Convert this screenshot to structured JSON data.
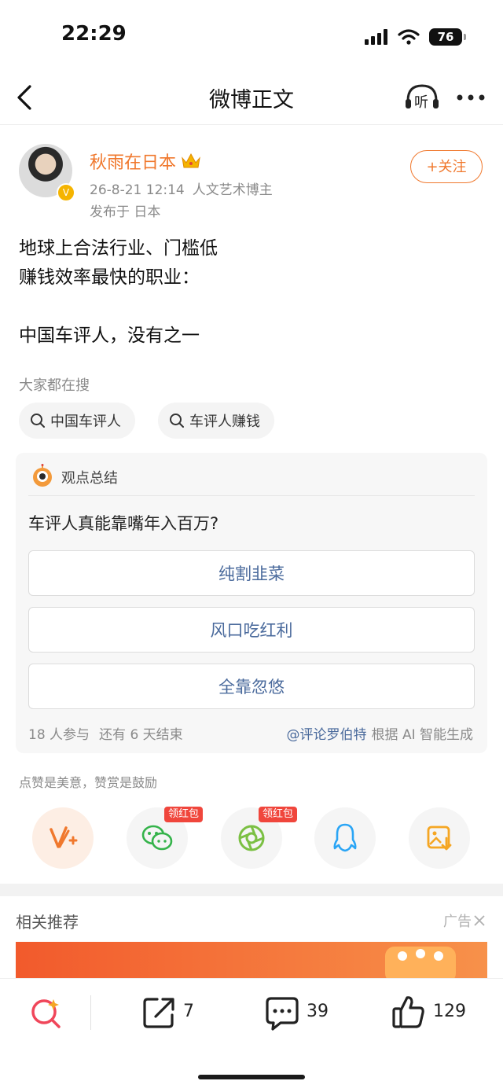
{
  "status": {
    "time": "22:29",
    "battery": "76"
  },
  "nav": {
    "title": "微博正文",
    "listen": "听"
  },
  "post": {
    "author": "秋雨在日本",
    "date": "26-8-21 12:14",
    "tag": "人文艺术博主",
    "location": "发布于 日本",
    "follow": "+关注",
    "lines": [
      "地球上合法行业、门槛低",
      "赚钱效率最快的职业：",
      "中国车评人，没有之一"
    ]
  },
  "search": {
    "label": "大家都在搜",
    "chips": [
      "中国车评人",
      "车评人赚钱"
    ]
  },
  "summary": {
    "title": "观点总结",
    "question": "车评人真能靠嘴年入百万?",
    "options": [
      "纯割韭菜",
      "风口吃红利",
      "全靠忽悠"
    ],
    "participants": "18 人参与",
    "remaining": "还有 6 天结束",
    "bot": "@评论罗伯特",
    "generated": "根据 AI 智能生成"
  },
  "reward_hint": "点赞是美意，赞赏是鼓励",
  "share": {
    "badge": "领红包"
  },
  "related": {
    "title": "相关推荐",
    "ad": "广告"
  },
  "bottom": {
    "reposts": "7",
    "comments": "39",
    "likes": "129"
  },
  "colors": {
    "accent": "#f0782d",
    "link": "#4a6a9c",
    "badge": "#f0463c"
  }
}
